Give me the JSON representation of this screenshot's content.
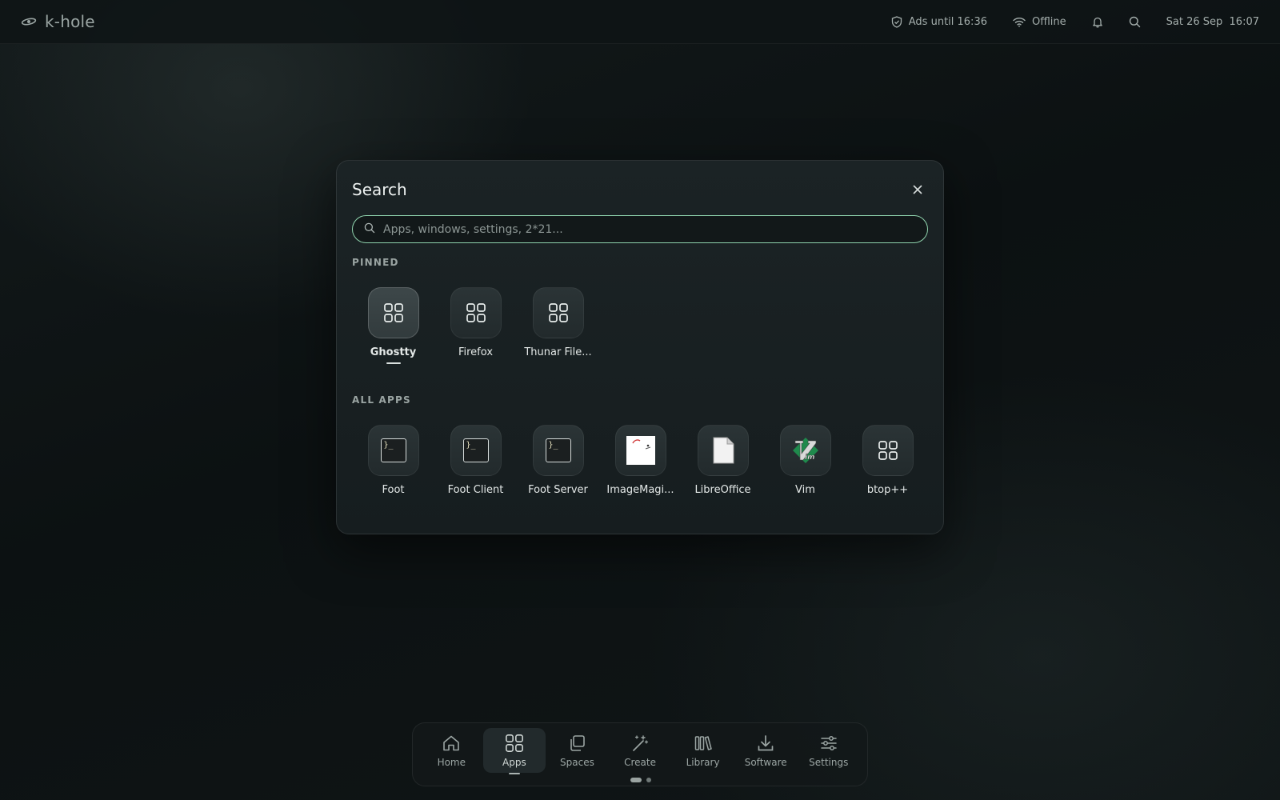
{
  "topbar": {
    "brand": "k-hole",
    "ads": "Ads until 16:36",
    "network": "Offline",
    "datetime": "Sat 26 Sep  16:07"
  },
  "search": {
    "title": "Search",
    "placeholder": "Apps, windows, settings, 2*21...",
    "value": ""
  },
  "pinned": {
    "label": "PINNED",
    "apps": [
      {
        "label": "Ghostty",
        "icon": "grid-icon",
        "selected": true
      },
      {
        "label": "Firefox",
        "icon": "grid-icon"
      },
      {
        "label": "Thunar File...",
        "icon": "grid-icon"
      }
    ]
  },
  "all_apps": {
    "label": "ALL APPS",
    "apps": [
      {
        "label": "Foot",
        "icon": "terminal-icon"
      },
      {
        "label": "Foot Client",
        "icon": "terminal-icon"
      },
      {
        "label": "Foot Server",
        "icon": "terminal-icon"
      },
      {
        "label": "ImageMagi...",
        "icon": "imagemagick-icon"
      },
      {
        "label": "LibreOffice",
        "icon": "libreoffice-icon"
      },
      {
        "label": "Vim",
        "icon": "vim-icon"
      },
      {
        "label": "btop++",
        "icon": "grid-icon"
      }
    ]
  },
  "dock": {
    "items": [
      {
        "label": "Home",
        "icon": "home-icon"
      },
      {
        "label": "Apps",
        "icon": "apps-icon",
        "active": true
      },
      {
        "label": "Spaces",
        "icon": "spaces-icon"
      },
      {
        "label": "Create",
        "icon": "create-icon"
      },
      {
        "label": "Library",
        "icon": "library-icon"
      },
      {
        "label": "Software",
        "icon": "download-icon"
      },
      {
        "label": "Settings",
        "icon": "sliders-icon"
      }
    ]
  },
  "colors": {
    "accent": "#8fd3ad",
    "background": "#0f1516",
    "dialog": "#1a2224"
  }
}
